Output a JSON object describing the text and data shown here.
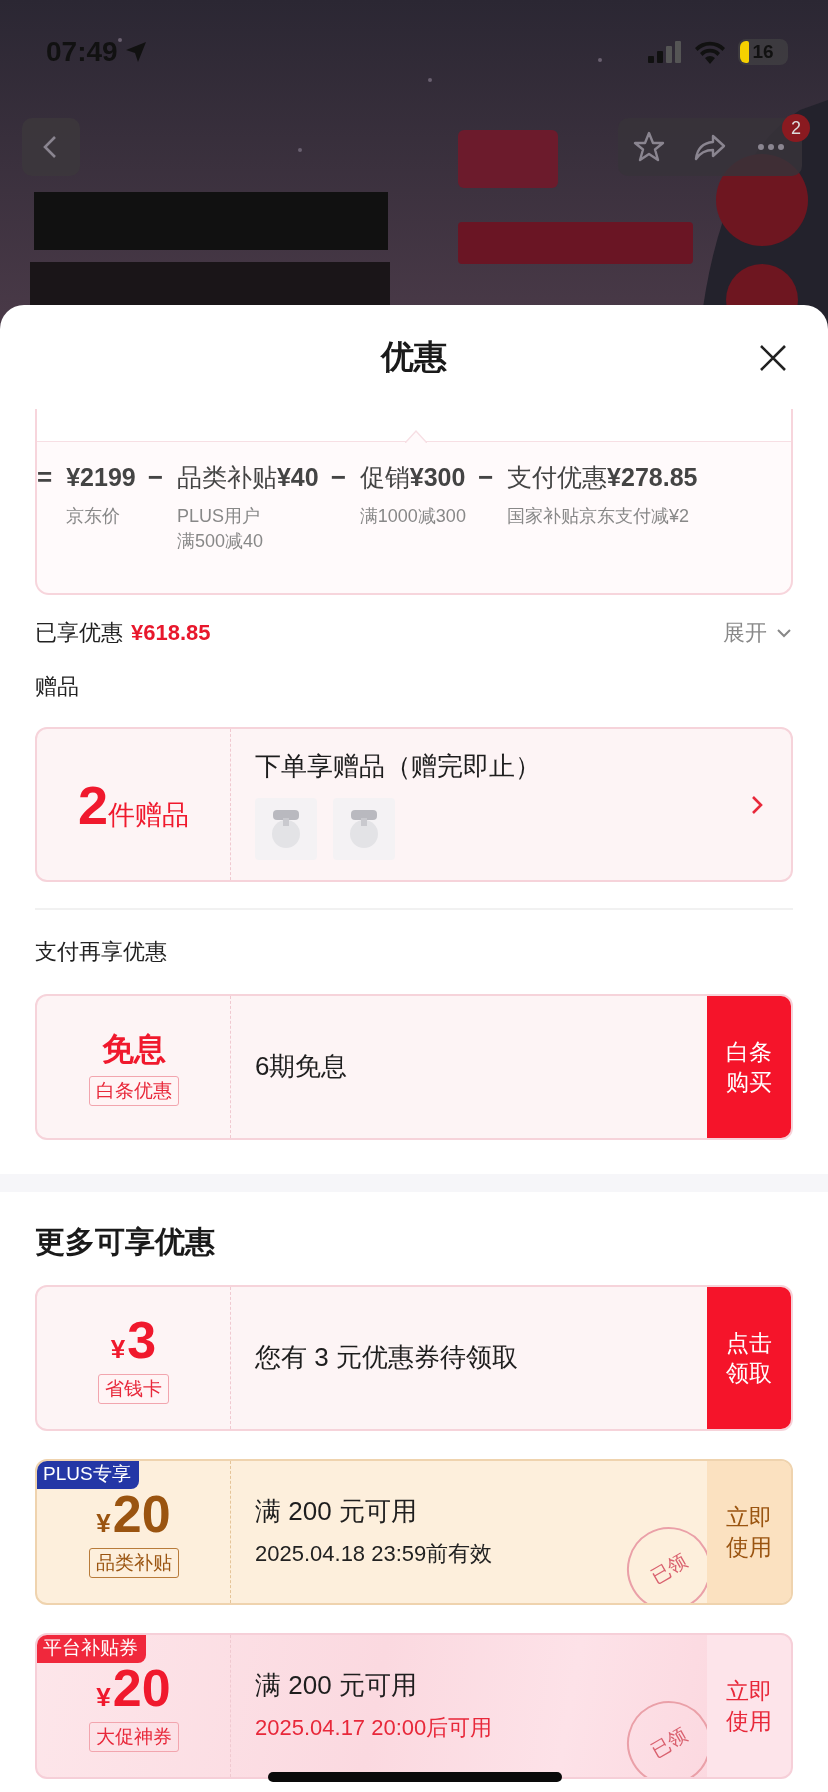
{
  "status_bar": {
    "time": "07:49",
    "battery": "16"
  },
  "banner": {
    "kind": "picture",
    "cart_badge": "2"
  },
  "sheet": {
    "title": "优惠"
  },
  "price_breakdown": {
    "items": [
      {
        "operator": "=",
        "amount": "¥2199",
        "notes": [
          "京东价"
        ]
      },
      {
        "operator": "−",
        "label": "品类补贴",
        "amount": "¥40",
        "notes": [
          "PLUS用户",
          "满500减40"
        ]
      },
      {
        "operator": "−",
        "label": "促销",
        "amount": "¥300",
        "notes": [
          "满1000减300"
        ]
      },
      {
        "operator": "−",
        "label": "支付优惠",
        "amount": "¥278.85",
        "notes": [
          "国家补贴京东支付减¥2"
        ]
      }
    ]
  },
  "savings": {
    "label": "已享优惠",
    "amount": "¥618.85",
    "toggle": "展开"
  },
  "gifts": {
    "heading": "赠品",
    "card": {
      "count": "2",
      "unit": "件赠品",
      "title": "下单享赠品（赠完即止）"
    }
  },
  "payment": {
    "heading": "支付再享优惠",
    "cards": [
      {
        "kind": "standard",
        "main": "免息",
        "tag": "白条优惠",
        "title": "6期免息",
        "action": "白条购买"
      }
    ]
  },
  "more": {
    "heading": "更多可享优惠",
    "cards": [
      {
        "kind": "standard",
        "currency": "¥",
        "main": "3",
        "tag": "省钱卡",
        "title": "您有 3 元优惠券待领取",
        "action": "点击领取"
      },
      {
        "kind": "plus",
        "ribbon": "PLUS专享",
        "currency": "¥",
        "main": "20",
        "tag": "品类补贴",
        "title": "满 200 元可用",
        "note": "2025.04.18 23:59前有效",
        "stamp": "已领",
        "action": "立即使用"
      },
      {
        "kind": "platform",
        "ribbon": "平台补贴券",
        "currency": "¥",
        "main": "20",
        "tag": "大促神券",
        "title": "满 200 元可用",
        "note": "2025.04.17 20:00后可用",
        "stamp": "已领",
        "action": "立即使用"
      }
    ]
  }
}
